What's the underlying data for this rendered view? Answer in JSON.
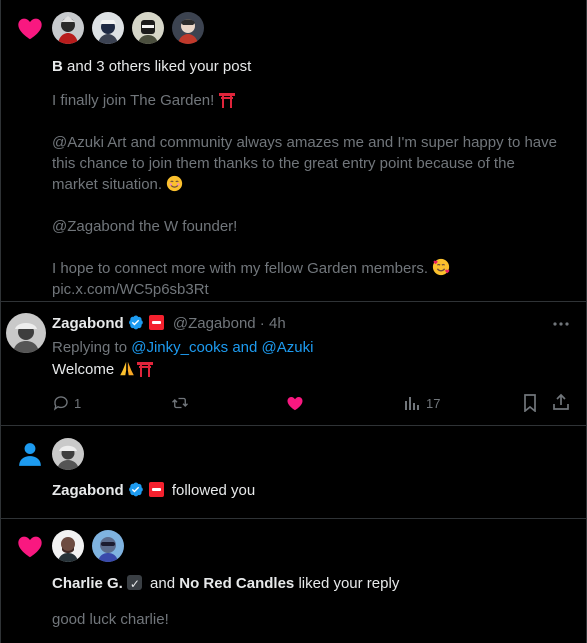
{
  "colors": {
    "heart": "#f91880",
    "blue": "#1d9bf0",
    "text": "#e7e9ea",
    "muted": "#71767b",
    "border": "#2f3336"
  },
  "notif1": {
    "icon": "heart-icon",
    "actor": "B",
    "summary_rest": " and 3 others liked your post",
    "post": {
      "line1": "I finally join The Garden! ",
      "line2a": "@Azuki Art and community always amazes me and I'm super happy to have",
      "line2b": "this chance to join them thanks to the great entry point because of the",
      "line2c": "market situation. ",
      "line3": "@Zagabond the W founder!",
      "line4": "I hope to connect more with my fellow Garden members. ",
      "line5": "pic.x.com/WC5p6sb3Rt"
    }
  },
  "reply": {
    "name": "Zagabond",
    "handle": "@Zagabond",
    "dot": " · ",
    "time": "4h",
    "replying_prefix": "Replying to ",
    "replying_to": "@Jinky_cooks and @Azuki",
    "text": "Welcome ",
    "more_icon": "more-icon",
    "actions": {
      "replies": "1",
      "views": "17"
    }
  },
  "notif2": {
    "icon": "person-icon",
    "name": "Zagabond",
    "text": "followed you"
  },
  "notif3": {
    "icon": "heart-icon",
    "name1": "Charlie G.",
    "and": "and",
    "name2": "No Red Candles",
    "summary_rest": "liked your reply",
    "snippet": "good luck charlie!"
  }
}
